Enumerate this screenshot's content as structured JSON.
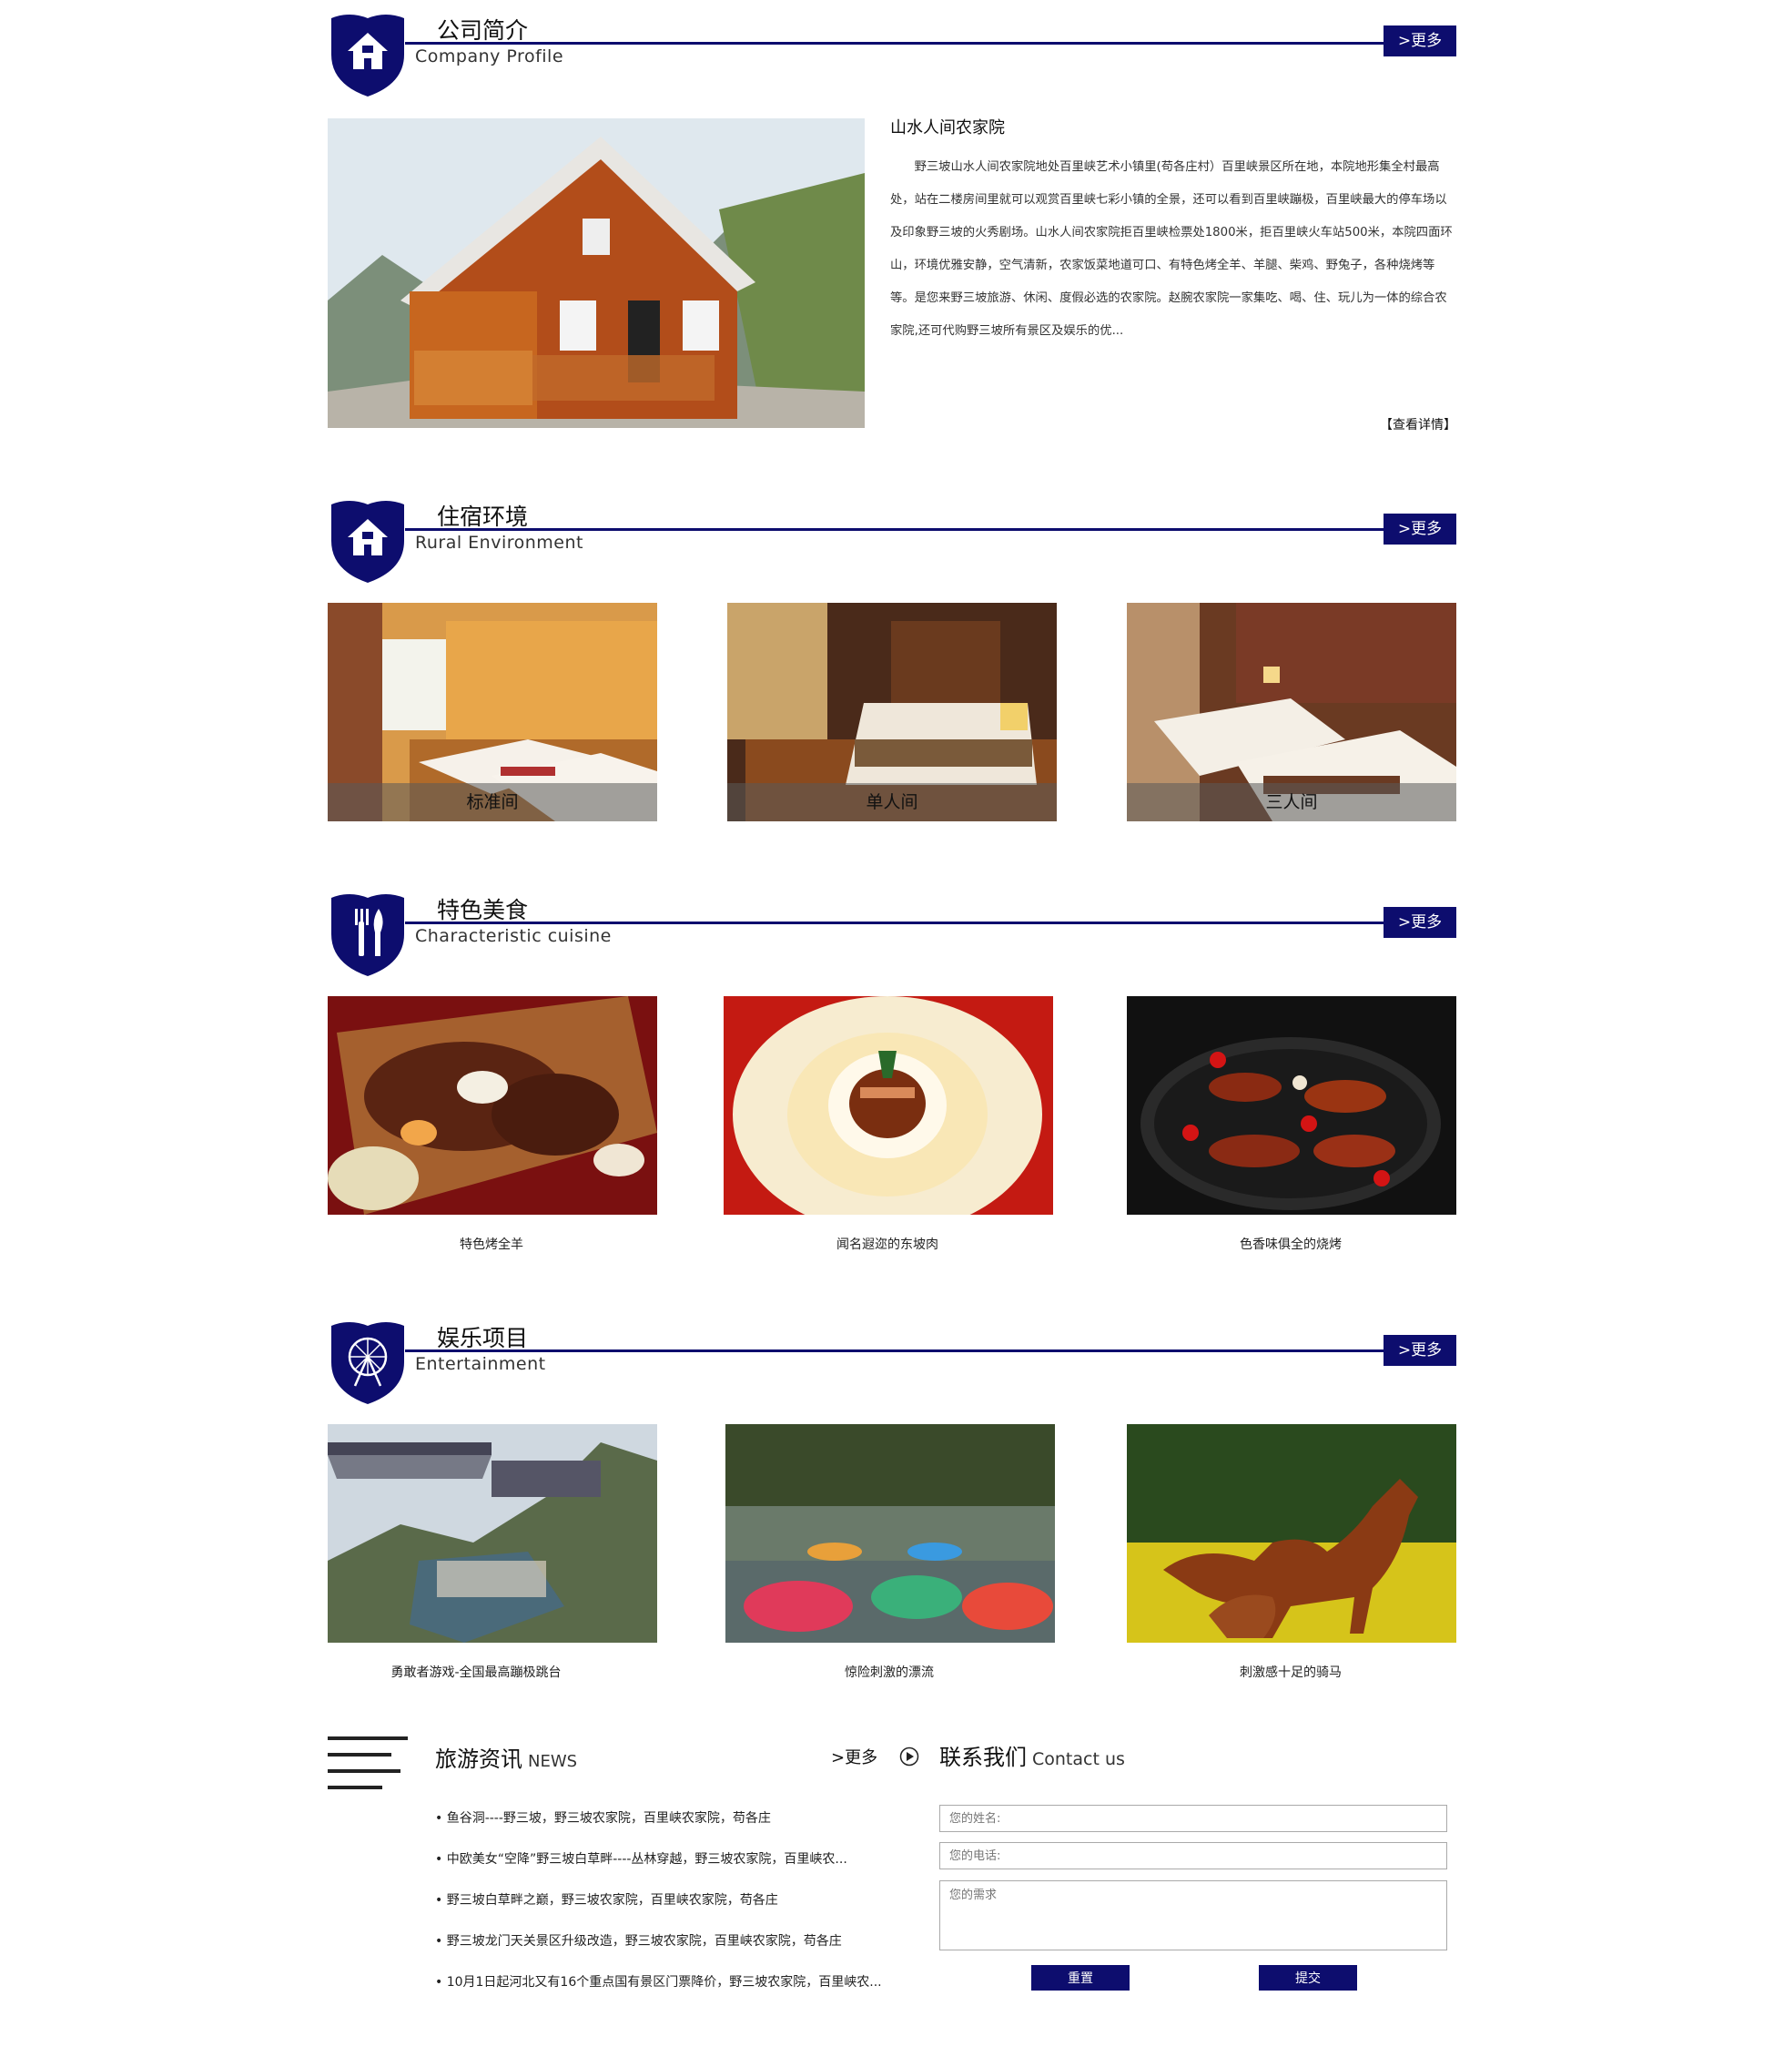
{
  "sections": {
    "profile": {
      "title": "公司简介",
      "subtitle": "Company Profile",
      "more": ">更多"
    },
    "rooms": {
      "title": "住宿环境",
      "subtitle": "Rural Environment",
      "more": ">更多"
    },
    "food": {
      "title": "特色美食",
      "subtitle": "Characteristic cuisine",
      "more": ">更多"
    },
    "fun": {
      "title": "娱乐项目",
      "subtitle": "Entertainment",
      "more": ">更多"
    }
  },
  "intro": {
    "heading": "山水人间农家院",
    "text": "野三坡山水人间农家院地处百里峡艺术小镇里(苟各庄村）百里峡景区所在地，本院地形集全村最高处，站在二楼房间里就可以观赏百里峡七彩小镇的全景，还可以看到百里峡蹦极，百里峡最大的停车场以及印象野三坡的火秀剧场。山水人间农家院拒百里峡检票处1800米，拒百里峡火车站500米，本院四面环山，环境优雅安静，空气清新，农家饭菜地道可口、有特色烤全羊、羊腿、柴鸡、野兔子，各种烧烤等等。是您来野三坡旅游、休闲、度假必选的农家院。赵腕农家院一家集吃、喝、住、玩儿为一体的综合农家院,还可代购野三坡所有景区及娱乐的优...",
    "detail_link": "【查看详情】"
  },
  "rooms": [
    {
      "label": "标准间"
    },
    {
      "label": "单人间"
    },
    {
      "label": "三人间"
    }
  ],
  "food": [
    {
      "label": "特色烤全羊"
    },
    {
      "label": "闻名遐迩的东坡肉"
    },
    {
      "label": "色香味俱全的烧烤"
    }
  ],
  "fun": [
    {
      "label": "勇敢者游戏-全国最高蹦极跳台"
    },
    {
      "label": "惊险刺激的漂流"
    },
    {
      "label": "刺激感十足的骑马"
    }
  ],
  "news": {
    "title": "旅游资讯",
    "title_en": "NEWS",
    "more": ">更多",
    "items": [
      "• 鱼谷洞----野三坡，野三坡农家院，百里峡农家院，苟各庄",
      "• 中欧美女“空降”野三坡白草畔----丛林穿越，野三坡农家院，百里峡农...",
      "• 野三坡白草畔之巅，野三坡农家院，百里峡农家院，苟各庄",
      "• 野三坡龙门天关景区升级改造，野三坡农家院，百里峡农家院，苟各庄",
      "• 10月1日起河北又有16个重点国有景区门票降价，野三坡农家院，百里峡农..."
    ]
  },
  "contact": {
    "title": "联系我们",
    "title_en": "Contact us",
    "name_placeholder": "您的姓名:",
    "phone_placeholder": "您的电话:",
    "need_placeholder": "您的需求",
    "reset": "重置",
    "submit": "提交"
  },
  "colors": {
    "accent": "#0d0d6e"
  },
  "icons": {
    "house": "house-icon",
    "cutlery": "cutlery-icon",
    "ferris": "ferris-wheel-icon",
    "menu": "menu-lines-icon",
    "arrow": "circle-arrow-icon"
  }
}
